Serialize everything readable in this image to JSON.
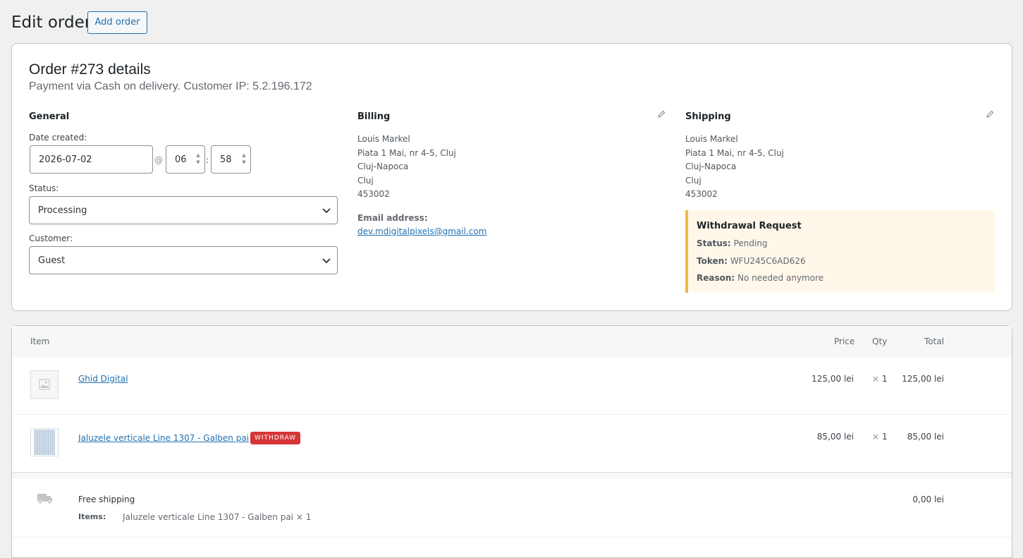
{
  "page": {
    "title": "Edit order",
    "add_order_label": "Add order"
  },
  "order": {
    "heading": "Order #273 details",
    "meta": "Payment via Cash on delivery. Customer IP: 5.2.196.172"
  },
  "general": {
    "title": "General",
    "date_label": "Date created:",
    "date_value": "2026-07-02",
    "at_sign": "@",
    "hour": "06",
    "colon": ":",
    "minute": "58",
    "status_label": "Status:",
    "status_value": "Processing",
    "customer_label": "Customer:",
    "customer_value": "Guest"
  },
  "billing": {
    "title": "Billing",
    "lines": [
      "Louis Markel",
      "Piata 1 Mai, nr 4-5, Cluj",
      "Cluj-Napoca",
      "Cluj",
      "453002"
    ],
    "email_label": "Email address:",
    "email": "dev.mdigitalpixels@gmail.com"
  },
  "shipping": {
    "title": "Shipping",
    "lines": [
      "Louis Markel",
      "Piata 1 Mai, nr 4-5, Cluj",
      "Cluj-Napoca",
      "Cluj",
      "453002"
    ]
  },
  "withdrawal": {
    "title": "Withdrawal Request",
    "status_label": "Status:",
    "status_value": "Pending",
    "token_label": "Token:",
    "token_value": "WFU245C6AD626",
    "reason_label": "Reason:",
    "reason_value": "No needed anymore"
  },
  "items_table": {
    "headers": {
      "item": "Item",
      "price": "Price",
      "qty": "Qty",
      "total": "Total"
    },
    "rows": [
      {
        "name": "Ghid Digital",
        "price": "125,00 lei",
        "qty_x": "×",
        "qty": "1",
        "total": "125,00 lei",
        "badge": ""
      },
      {
        "name": "Jaluzele verticale Line 1307 - Galben pai",
        "price": "85,00 lei",
        "qty_x": "×",
        "qty": "1",
        "total": "85,00 lei",
        "badge": "WITHDRAW"
      }
    ],
    "shipping": {
      "name": "Free shipping",
      "items_label": "Items:",
      "items_value": "Jaluzele verticale Line 1307 - Galben pai × 1",
      "total": "0,00 lei"
    }
  },
  "icons": {
    "edit": "pencil-icon",
    "placeholder": "image-placeholder-icon",
    "shipping": "truck-icon",
    "dropdown": "chevron-down-icon"
  },
  "colors": {
    "accent": "#2271b1",
    "badge": "#d63638",
    "notice_border": "#f0b849",
    "notice_bg": "#fff8ea"
  }
}
